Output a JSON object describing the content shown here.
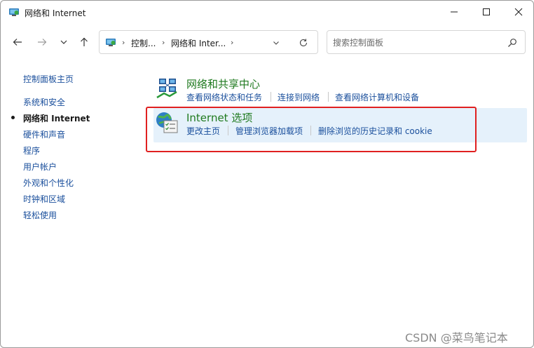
{
  "window": {
    "title": "网络和 Internet"
  },
  "address": {
    "segments": [
      "控制...",
      "网络和 Inter..."
    ]
  },
  "search": {
    "placeholder": "搜索控制面板"
  },
  "sidebar": {
    "home_label": "控制面板主页",
    "items": [
      {
        "label": "系统和安全"
      },
      {
        "label": "网络和 Internet"
      },
      {
        "label": "硬件和声音"
      },
      {
        "label": "程序"
      },
      {
        "label": "用户帐户"
      },
      {
        "label": "外观和个性化"
      },
      {
        "label": "时钟和区域"
      },
      {
        "label": "轻松使用"
      }
    ]
  },
  "categories": [
    {
      "title": "网络和共享中心",
      "links": [
        "查看网络状态和任务",
        "连接到网络",
        "查看网络计算机和设备"
      ]
    },
    {
      "title": "Internet 选项",
      "links": [
        "更改主页",
        "管理浏览器加载项",
        "删除浏览的历史记录和 cookie"
      ]
    }
  ],
  "watermark": "CSDN @菜鸟笔记本",
  "colors": {
    "link": "#1a4f9c",
    "category_title": "#1f7a1f",
    "selected_row_bg": "#e5f1fb",
    "highlight_border": "#e02020"
  }
}
